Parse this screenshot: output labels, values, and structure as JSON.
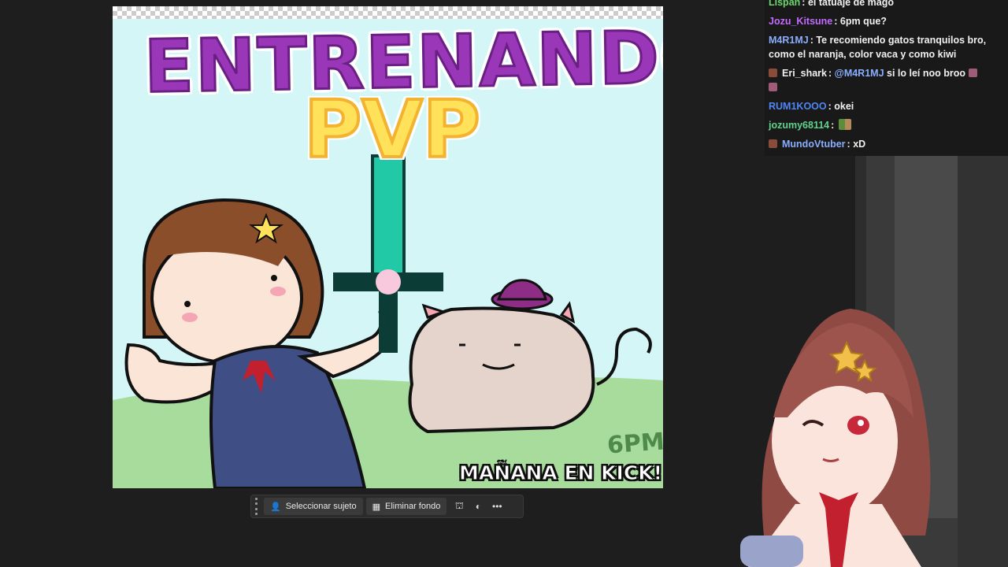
{
  "canvas": {
    "title_main": "ENTRENANDO",
    "title_sub": "PVP",
    "time_label": "6PM",
    "caption": "MAÑANA EN KICK!! ü"
  },
  "toolbar": {
    "select_subject_label": "Seleccionar sujeto",
    "remove_background_label": "Eliminar fondo",
    "more_label": "•••"
  },
  "chat": {
    "messages": [
      {
        "user": "Lispan",
        "user_color": "#6cd66c",
        "text": "el tatuaje de mago"
      },
      {
        "user": "Jozu_Kitsune",
        "user_color": "#c36bff",
        "text": "6pm que?"
      },
      {
        "user": "M4R1MJ",
        "user_color": "#8aaeff",
        "text": "Te recomiendo gatos tranquilos bro, como el naranja, color vaca y como kiwi"
      },
      {
        "user": "Eri_shark",
        "user_color": "#f0f0f0",
        "mention": "@M4R1MJ",
        "text": "si lo leí noo broo"
      },
      {
        "user": "RUM1KOOO",
        "user_color": "#4f86f7",
        "text": "okei"
      },
      {
        "user": "jozumy68114",
        "user_color": "#5fd38a",
        "text": ""
      },
      {
        "user": "MundoVtuber",
        "user_color": "#8aaeff",
        "text": "xD"
      }
    ]
  },
  "colors": {
    "title_purple": "#9a37b8",
    "pvp_yellow": "#ffe25a",
    "sword_teal": "#22c9a6",
    "app_bg": "#1e1e1e"
  }
}
